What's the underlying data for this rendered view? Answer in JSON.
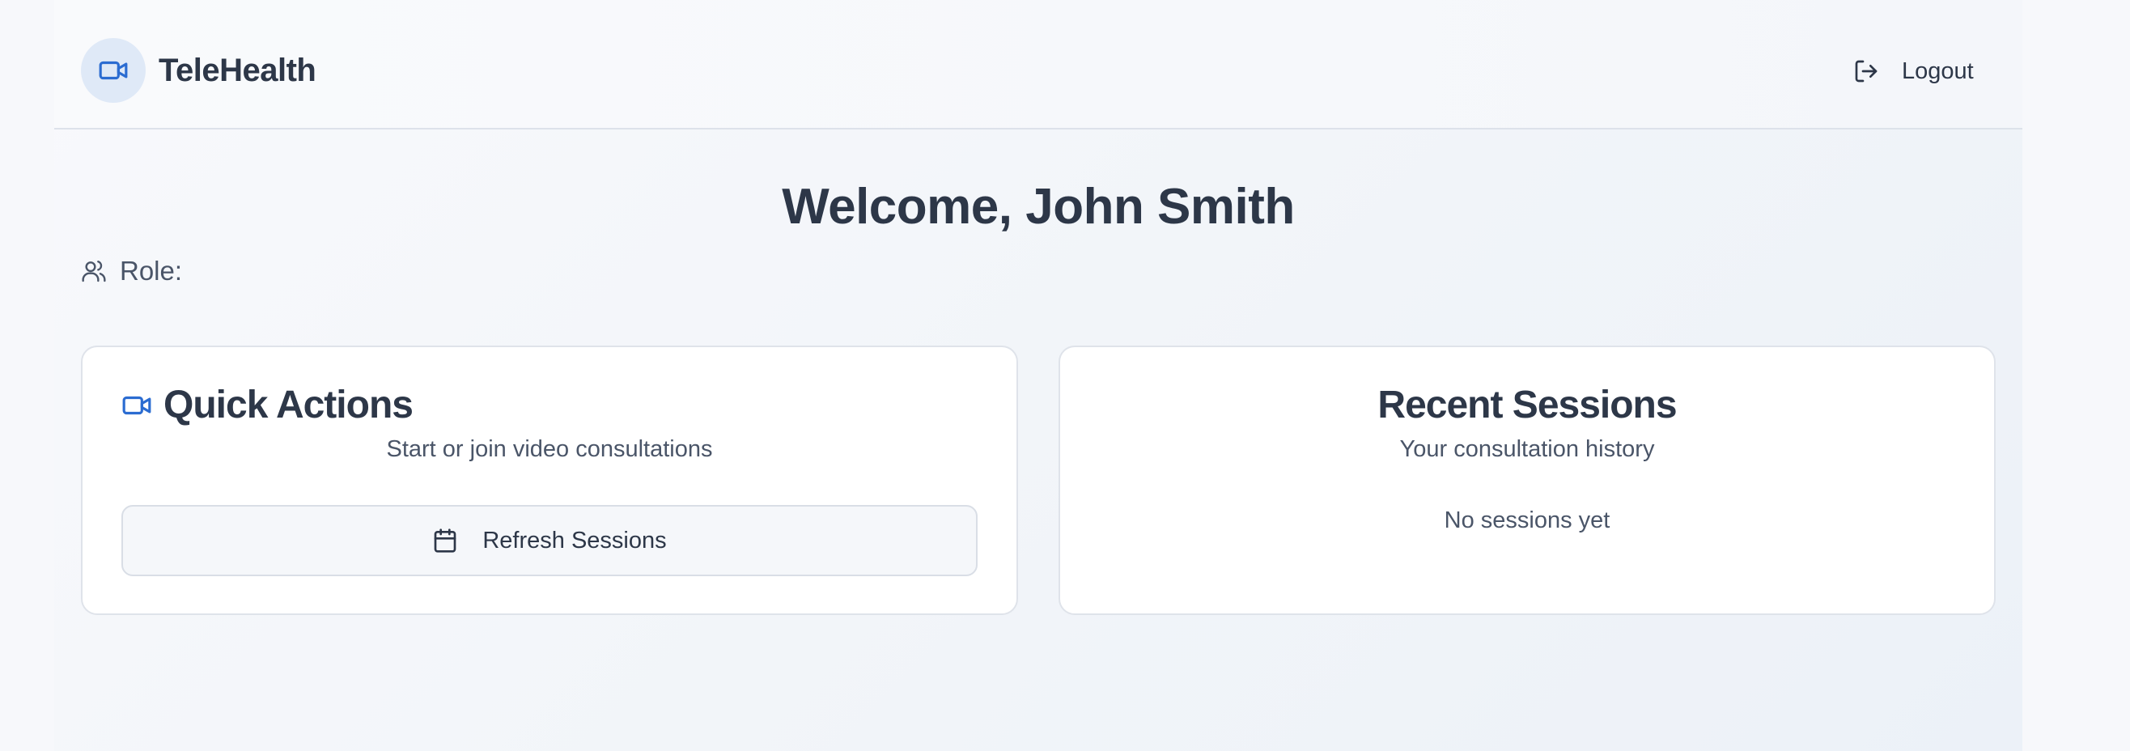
{
  "header": {
    "brand_name": "TeleHealth",
    "brand_icon": "video-camera-icon",
    "logout_label": "Logout",
    "logout_icon": "logout-icon"
  },
  "main": {
    "welcome": "Welcome, John Smith",
    "role_label": "Role:",
    "role_icon": "users-icon"
  },
  "quick_actions": {
    "title": "Quick Actions",
    "subtitle": "Start or join video consultations",
    "refresh_label": "Refresh Sessions",
    "refresh_icon": "calendar-icon"
  },
  "recent_sessions": {
    "title": "Recent Sessions",
    "subtitle": "Your consultation history",
    "empty_text": "No sessions yet"
  },
  "colors": {
    "accent": "#2b6cd1",
    "text": "#2d3748",
    "muted": "#4a5568"
  }
}
